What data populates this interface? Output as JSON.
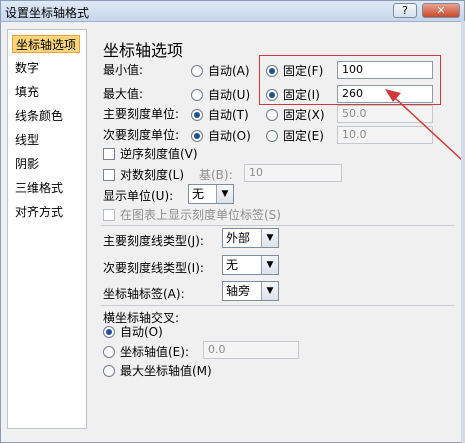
{
  "window": {
    "title": "设置坐标轴格式",
    "help_label": "?",
    "close_label": "✕"
  },
  "sidebar": {
    "items": [
      {
        "label": "坐标轴选项",
        "selected": true
      },
      {
        "label": "数字"
      },
      {
        "label": "填充"
      },
      {
        "label": "线条颜色"
      },
      {
        "label": "线型"
      },
      {
        "label": "阴影"
      },
      {
        "label": "三维格式"
      },
      {
        "label": "对齐方式"
      }
    ]
  },
  "panel": {
    "heading": "坐标轴选项",
    "min": {
      "label": "最小值:",
      "auto": "自动(A)",
      "fixed": "固定(F)",
      "value": "100"
    },
    "max": {
      "label": "最大值:",
      "auto": "自动(U)",
      "fixed": "固定(I)",
      "value": "260"
    },
    "major": {
      "label": "主要刻度单位:",
      "auto": "自动(T)",
      "fixed": "固定(X)",
      "value": "50.0"
    },
    "minor": {
      "label": "次要刻度单位:",
      "auto": "自动(O)",
      "fixed": "固定(E)",
      "value": "10.0"
    },
    "reverse": {
      "label": "逆序刻度值(V)"
    },
    "log": {
      "label": "对数刻度(L)",
      "base_label": "基(B):",
      "base_value": "10"
    },
    "display_units": {
      "label": "显示单位(U):",
      "value": "无"
    },
    "show_units_label": {
      "label": "在图表上显示刻度单位标签(S)"
    },
    "major_tick_type": {
      "label": "主要刻度线类型(J):",
      "value": "外部"
    },
    "minor_tick_type": {
      "label": "次要刻度线类型(I):",
      "value": "无"
    },
    "axis_labels": {
      "label": "坐标轴标签(A):",
      "value": "轴旁"
    },
    "cross": {
      "title": "横坐标轴交叉:",
      "auto": "自动(O)",
      "axis_value": "坐标轴值(E):",
      "axis_value_input": "0.0",
      "max_value": "最大坐标轴值(M)"
    }
  },
  "colors": {
    "annotation": "#d13a3a",
    "selection": "#fbd47c"
  }
}
